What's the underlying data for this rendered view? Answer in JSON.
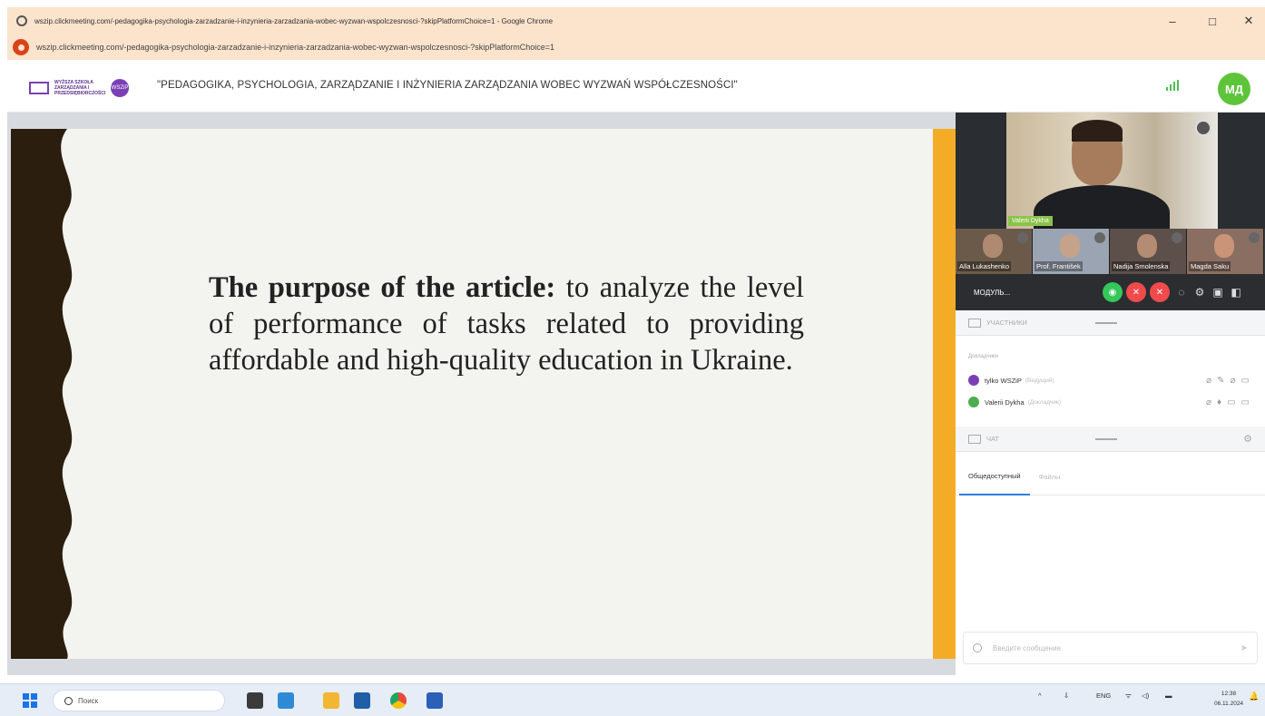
{
  "window": {
    "title": "wszip.clickmeeting.com/-pedagogika-psychologia-zarzadzanie-i-inzynieria-zarzadzania-wobec-wyzwan-wspolczesnosci-?skipPlatformChoice=1 - Google Chrome",
    "minimize": "–",
    "maximize": "□",
    "close": "✕"
  },
  "address_bar": {
    "url": "wszip.clickmeeting.com/-pedagogika-psychologia-zarzadzanie-i-inzynieria-zarzadzania-wobec-wyzwan-wspolczesnosci-?skipPlatformChoice=1"
  },
  "header": {
    "logo_text": "WYŻSZA SZKOŁA ZARZĄDZANIA I PRZEDSIĘBIORCZOŚCI",
    "logo_badge": "WSZiP",
    "event_title": "\"PEDAGOGIKA, PSYCHOLOGIA, ZARZĄDZANIE I INŻYNIERIA ZARZĄDZANIA WOBEC WYZWAŃ WSPÓŁCZESNOŚCI\"",
    "user_initials": "МД"
  },
  "slide": {
    "bold_lead": "The purpose of the article:",
    "body": " to analyze the level of performance of tasks related to providing affordable and high-quality education in Ukraine.",
    "colors": {
      "background": "#f3f3ef",
      "wave": "#2b1e0e",
      "accent": "#f4ac27"
    }
  },
  "video": {
    "main_name": "Valerii Dykha",
    "thumbnails": [
      {
        "name": "Alla Lukashenko"
      },
      {
        "name": "Prof. František"
      },
      {
        "name": "Nadija Smolenska"
      },
      {
        "name": "Magda Saku"
      }
    ]
  },
  "controls": {
    "meeting_label": "МОДУЛЬ...",
    "camera": "◉",
    "mic": "✕",
    "leave": "✕",
    "chat_icon": "◌",
    "settings_icon": "⚙",
    "screen_icon": "▣",
    "layout_icon": "◧"
  },
  "participants": {
    "header": "Участники",
    "group": "Докладчики",
    "rows": [
      {
        "name": "tylko WSZiP",
        "role": "(Ведущий)",
        "color": "#7b3fb5",
        "icons": [
          "⌀",
          "✎",
          "⌀",
          "▭"
        ]
      },
      {
        "name": "Valerii Dykha",
        "role": "(Докладчик)",
        "color": "#4cae4c",
        "icons": [
          "⌀",
          "♦",
          "▭",
          "▭"
        ]
      }
    ]
  },
  "chat": {
    "header": "Чат",
    "settings": "⚙",
    "tabs": [
      {
        "label": "Общедоступный",
        "active": true
      },
      {
        "label": "Файлы",
        "active": false
      }
    ],
    "input_placeholder": "Введите сообщение",
    "send": "➤"
  },
  "taskbar": {
    "search_placeholder": "Поиск",
    "lang": "ENG",
    "time": "12:38",
    "date": "06.11.2024",
    "tray_up": "^",
    "tray_usb": "⇩",
    "tray_net": "ᯤ",
    "tray_sound": "◁)",
    "tray_batt": "▬",
    "bell": "🔔"
  }
}
